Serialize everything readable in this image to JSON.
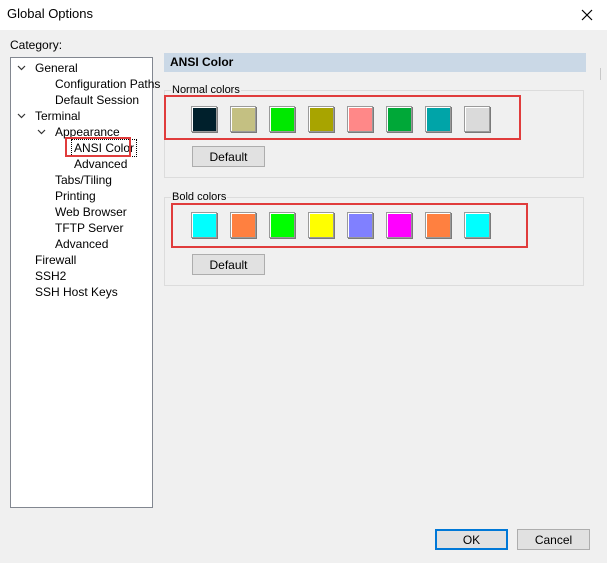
{
  "window": {
    "title": "Global Options"
  },
  "category": {
    "label": "Category:",
    "tree": [
      {
        "label": "General",
        "level": 0,
        "expanded": true
      },
      {
        "label": "Configuration Paths",
        "level": 1
      },
      {
        "label": "Default Session",
        "level": 1
      },
      {
        "label": "Terminal",
        "level": 0,
        "expanded": true
      },
      {
        "label": "Appearance",
        "level": 1,
        "expanded": true
      },
      {
        "label": "ANSI Color",
        "level": 2,
        "selected": true
      },
      {
        "label": "Advanced",
        "level": 2
      },
      {
        "label": "Tabs/Tiling",
        "level": 1
      },
      {
        "label": "Printing",
        "level": 1
      },
      {
        "label": "Web Browser",
        "level": 1
      },
      {
        "label": "TFTP Server",
        "level": 1
      },
      {
        "label": "Advanced",
        "level": 1
      },
      {
        "label": "Firewall",
        "level": 0
      },
      {
        "label": "SSH2",
        "level": 0
      },
      {
        "label": "SSH Host Keys",
        "level": 0
      }
    ]
  },
  "panel": {
    "header": "ANSI Color",
    "normal": {
      "label": "Normal colors",
      "colors": [
        "#00202c",
        "#c4c082",
        "#00e800",
        "#a8a400",
        "#ff8888",
        "#00a838",
        "#00a4a8",
        "#dadada"
      ],
      "default_label": "Default"
    },
    "bold": {
      "label": "Bold colors",
      "colors": [
        "#00ffff",
        "#ff8040",
        "#00ff00",
        "#ffff00",
        "#8080ff",
        "#ff00ff",
        "#ff8040",
        "#00ffff"
      ],
      "default_label": "Default"
    }
  },
  "footer": {
    "ok_label": "OK",
    "cancel_label": "Cancel"
  },
  "accent": {
    "highlight_red": "#e03c3c",
    "header_blue": "#cad8e6",
    "focus_blue": "#0078d7"
  }
}
